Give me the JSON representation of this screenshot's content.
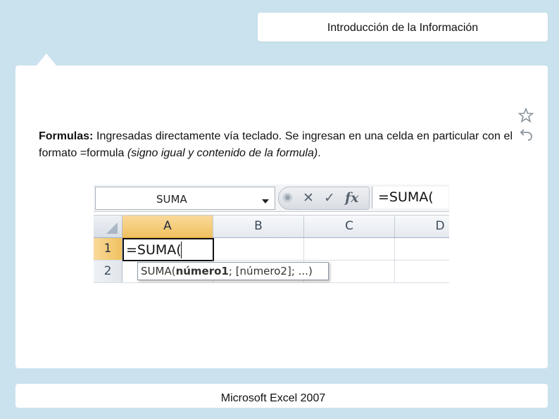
{
  "header": {
    "title": "Introducción de la Información"
  },
  "body": {
    "lead": "Formulas:",
    "text_before": " Ingresadas directamente vía teclado. Se ingresan en una celda en particular con el formato =formula ",
    "italic": "(signo igual y contenido de la formula)",
    "text_after": "."
  },
  "excel": {
    "name_box": "SUMA",
    "formula_bar": "=SUMA(",
    "columns": [
      "A",
      "B",
      "C",
      "D"
    ],
    "rows": [
      "1",
      "2"
    ],
    "active_cell_value": "=SUMA(",
    "tooltip": {
      "func": "SUMA(",
      "arg1": "número1",
      "rest": "; [número2]; ...)"
    }
  },
  "footer": {
    "text": "Microsoft Excel 2007"
  },
  "icons": {
    "star": "star-icon",
    "undo": "undo-icon",
    "x": "✕",
    "check": "✓",
    "fx": "fx"
  }
}
